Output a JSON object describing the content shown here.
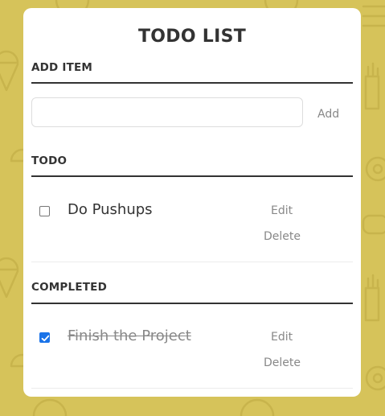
{
  "colors": {
    "background": "#d6c35a",
    "pattern": "#cbb64d",
    "card": "#ffffff",
    "text": "#333333",
    "muted": "#888888",
    "check": "#1a73e8"
  },
  "app": {
    "title": "TODO LIST"
  },
  "add_item": {
    "heading": "ADD ITEM",
    "input_value": "",
    "add_label": "Add"
  },
  "todo": {
    "heading": "TODO",
    "items": [
      {
        "text": "Do Pushups",
        "checked": false,
        "edit_label": "Edit",
        "delete_label": "Delete"
      }
    ]
  },
  "completed": {
    "heading": "COMPLETED",
    "items": [
      {
        "text": "Finish the Project",
        "checked": true,
        "edit_label": "Edit",
        "delete_label": "Delete"
      }
    ]
  },
  "icons": {
    "checkbox_unchecked": "checkbox-unchecked-icon",
    "checkbox_checked": "checkmark-icon",
    "background_pattern": "food-doodle-pattern"
  }
}
